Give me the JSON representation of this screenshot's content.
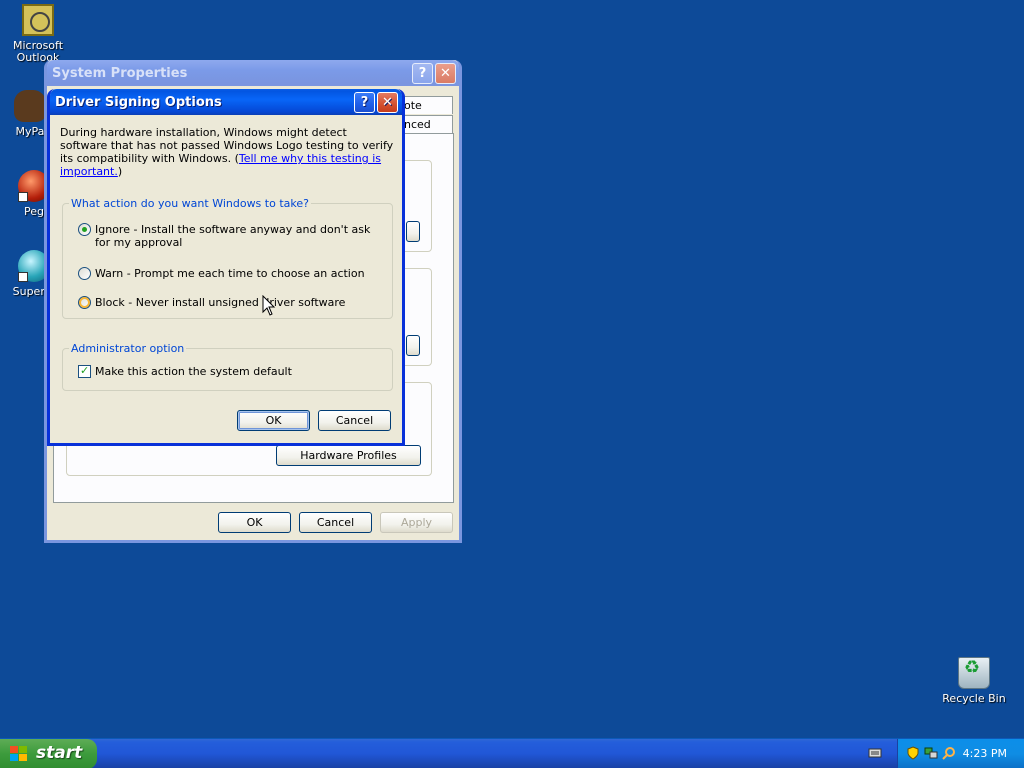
{
  "desktop": {
    "icons": [
      {
        "label": "Microsoft Outlook",
        "icon": "outlook-icon"
      },
      {
        "label": "MyPa",
        "icon": "mypal-icon"
      },
      {
        "label": "Peg",
        "icon": "pegasus-icon"
      },
      {
        "label": "Superm",
        "icon": "supermium-icon"
      },
      {
        "label": "Recycle Bin",
        "icon": "recycle-bin-icon"
      }
    ]
  },
  "system_properties": {
    "title": "System Properties",
    "help_symbol": "?",
    "close_symbol": "✕",
    "tabs": [
      "ote",
      "nced"
    ],
    "hardware_profiles_label": "Hardware Profiles",
    "ok_label": "OK",
    "cancel_label": "Cancel",
    "apply_label": "Apply"
  },
  "driver_signing": {
    "title": "Driver Signing Options",
    "help_symbol": "?",
    "close_symbol": "✕",
    "description": "During hardware installation, Windows might detect software that has not passed Windows Logo testing to verify its compatibility with Windows. (",
    "link_text": "Tell me why this testing is important.",
    "description_end": ")",
    "action_group_label": "What action do you want Windows to take?",
    "options": [
      {
        "label": "Ignore - Install the software anyway and don't ask for my approval",
        "checked": true
      },
      {
        "label": "Warn - Prompt me each time to choose an action",
        "checked": false
      },
      {
        "label": "Block - Never install unsigned driver software",
        "checked": false
      }
    ],
    "admin_group_label": "Administrator option",
    "default_checkbox_label": "Make this action the system default",
    "default_checked": true,
    "ok_label": "OK",
    "cancel_label": "Cancel"
  },
  "taskbar": {
    "start_label": "start",
    "clock": "4:23 PM",
    "tray_icons": [
      "keyboard-icon",
      "security-shield-icon",
      "network-icon",
      "search-icon"
    ]
  }
}
